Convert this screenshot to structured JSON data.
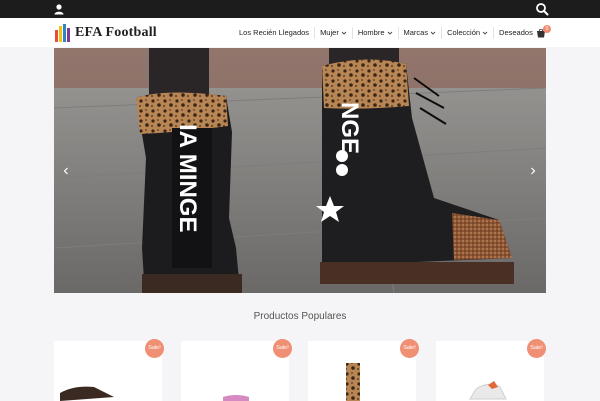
{
  "brand": {
    "name": "EFA Football"
  },
  "topbar": {
    "user_icon": "user-icon",
    "search_icon": "search-icon"
  },
  "nav": {
    "items": [
      {
        "label": "Los Recién Llegados",
        "dropdown": false
      },
      {
        "label": "Mujer",
        "dropdown": true
      },
      {
        "label": "Hombre",
        "dropdown": true
      },
      {
        "label": "Marcas",
        "dropdown": true
      },
      {
        "label": "Colección",
        "dropdown": true
      },
      {
        "label": "Deseados",
        "dropdown": false
      }
    ]
  },
  "cart": {
    "count": "0",
    "icon": "cart-icon"
  },
  "hero": {
    "boot_left_text": "IA MINGE",
    "boot_right_text": "NGE",
    "prev_icon": "chevron-left-icon",
    "next_icon": "chevron-right-icon"
  },
  "popular": {
    "title": "Productos Populares",
    "products": [
      {
        "badge": "Sale!"
      },
      {
        "badge": "Sale!"
      },
      {
        "badge": "Sale!"
      },
      {
        "badge": "Sale!"
      }
    ]
  },
  "colors": {
    "accent": "#ef8f74",
    "topbar": "#1c1c1c",
    "text": "#222222"
  }
}
